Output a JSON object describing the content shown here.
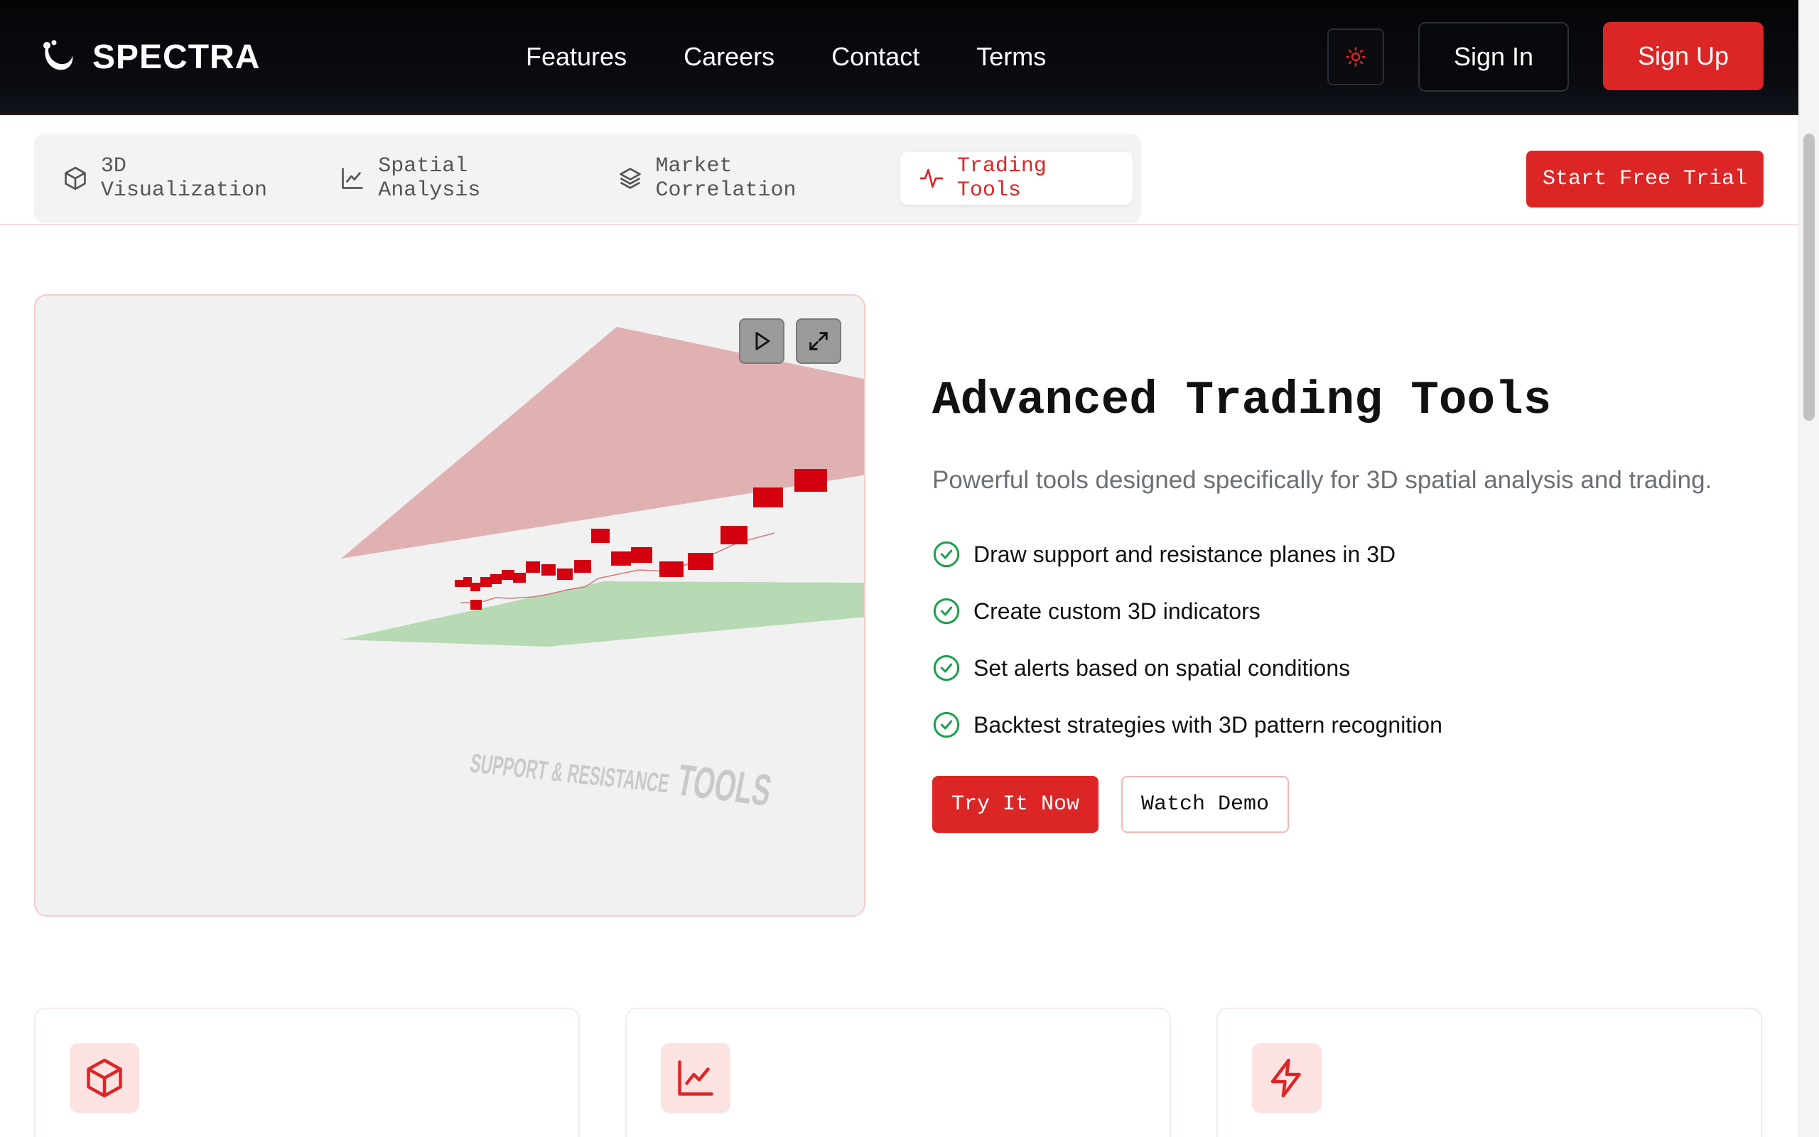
{
  "brand": {
    "name": "SPECTRA"
  },
  "nav": {
    "links": [
      "Features",
      "Careers",
      "Contact",
      "Terms"
    ],
    "signin_label": "Sign In",
    "signup_label": "Sign Up"
  },
  "tabs": [
    {
      "label": "3D Visualization",
      "icon": "cube-icon",
      "active": false
    },
    {
      "label": "Spatial Analysis",
      "icon": "line-chart-icon",
      "active": false
    },
    {
      "label": "Market Correlation",
      "icon": "layers-icon",
      "active": false
    },
    {
      "label": "Trading Tools",
      "icon": "activity-icon",
      "active": true
    }
  ],
  "trial_label": "Start Free Trial",
  "viz": {
    "caption_small": "SUPPORT & RESISTANCE",
    "caption_large": "TOOLS",
    "colors": {
      "resistance_plane": "#e0b1b1",
      "support_plane": "#b7d9b3",
      "points": "#d40010"
    }
  },
  "hero": {
    "title": "Advanced Trading Tools",
    "subtitle": "Powerful tools designed specifically for 3D spatial analysis and trading.",
    "features": [
      "Draw support and resistance planes in 3D",
      "Create custom 3D indicators",
      "Set alerts based on spatial conditions",
      "Backtest strategies with 3D pattern recognition"
    ],
    "try_label": "Try It Now",
    "demo_label": "Watch Demo"
  },
  "cards": [
    {
      "icon": "box-icon"
    },
    {
      "icon": "line-chart-icon"
    },
    {
      "icon": "lightning-icon"
    }
  ],
  "colors": {
    "accent": "#dc2626",
    "success": "#16a34a",
    "nav_bg": "#050507"
  }
}
